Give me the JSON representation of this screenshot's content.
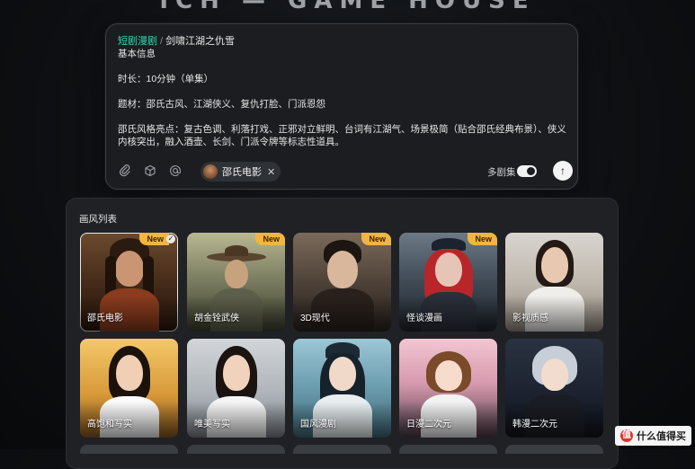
{
  "page_header": {
    "title": "ICH — GAME HOUSE"
  },
  "prompt": {
    "category": "短剧漫剧",
    "separator": "/",
    "title": "剑啸江湖之仇雪",
    "lines": [
      "基本信息",
      "",
      "时长：10分钟（单集）",
      "",
      "题材：邵氏古风、江湖侠义、复仇打脸、门派恩怨",
      "",
      "邵氏风格亮点：复古色调、利落打戏、正邪对立鲜明、台词有江湖气、场景极简（贴合邵氏经典布景）、侠义内核突出，融入酒壶、长剑、门派令牌等标志性道具。"
    ],
    "tools": {
      "attach_icon": "paperclip-icon",
      "model_icon": "cube-icon",
      "mention_icon": "at-icon"
    },
    "chip": {
      "label": "邵氏电影",
      "remove": "✕"
    },
    "multi_episode_label": "多剧集",
    "multi_episode_on": true,
    "send_icon": "↑"
  },
  "style_panel": {
    "title": "画风列表",
    "cards": [
      {
        "label": "邵氏电影",
        "badge": "New",
        "selected": true
      },
      {
        "label": "胡金铨武侠",
        "badge": "New",
        "selected": false
      },
      {
        "label": "3D现代",
        "badge": "New",
        "selected": false
      },
      {
        "label": "怪谈漫画",
        "badge": "New",
        "selected": false
      },
      {
        "label": "影视质感",
        "badge": "",
        "selected": false
      },
      {
        "label": "高饱和写实",
        "badge": "",
        "selected": false
      },
      {
        "label": "唯美写实",
        "badge": "",
        "selected": false
      },
      {
        "label": "国风漫剧",
        "badge": "",
        "selected": false
      },
      {
        "label": "日漫二次元",
        "badge": "",
        "selected": false
      },
      {
        "label": "韩漫二次元",
        "badge": "",
        "selected": false
      }
    ]
  },
  "watermark": {
    "logo": "值",
    "text": "什么值得买"
  },
  "colors": {
    "accent": "#3ad6b3",
    "badge": "#f0b544",
    "card_bg": "#1f2125"
  }
}
